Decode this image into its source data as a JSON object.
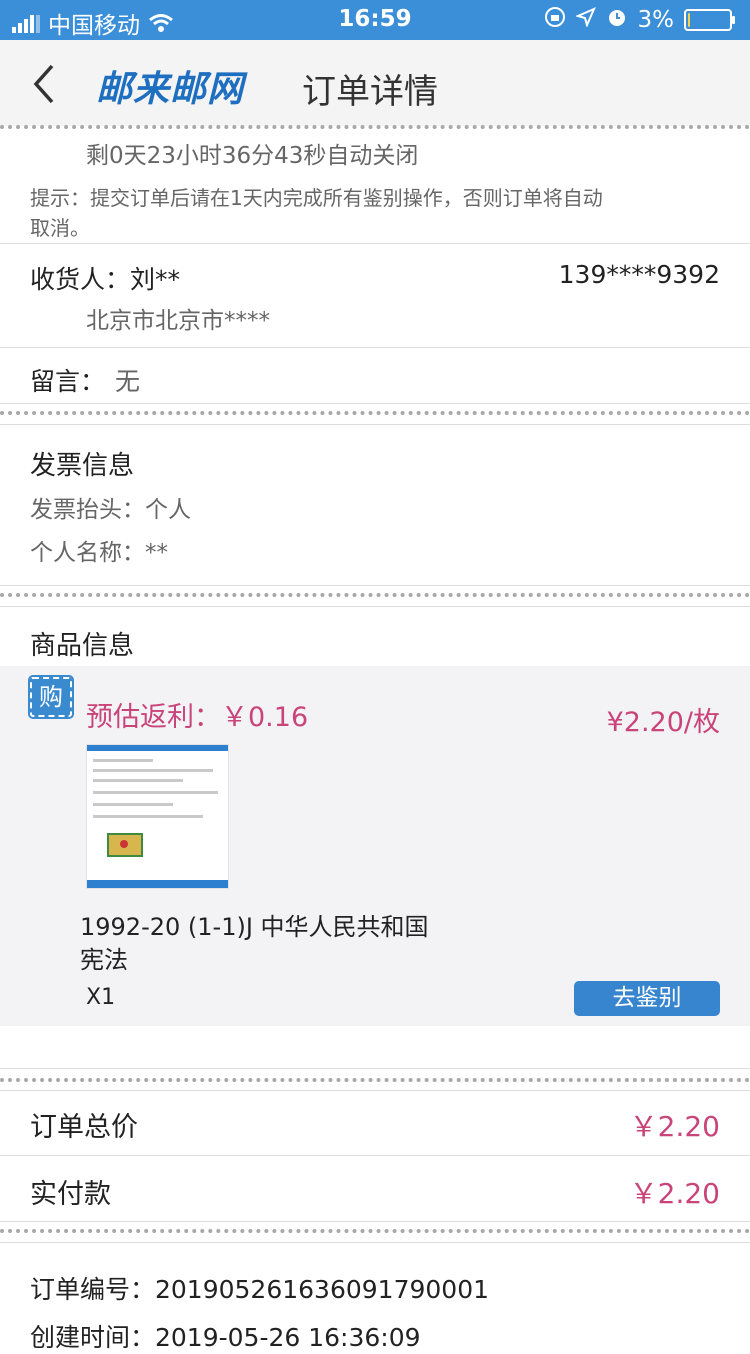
{
  "status_bar": {
    "carrier": "中国移动",
    "time": "16:59",
    "battery": "3%",
    "battery_level": 0.03
  },
  "nav": {
    "logo": "邮来邮网",
    "title": "订单详情"
  },
  "countdown": "剩0天23小时36分43秒自动关闭",
  "tip_line1": "提示：提交订单后请在1天内完成所有鉴别操作，否则订单将自动",
  "tip_line2": "取消。",
  "receiver": {
    "label": "收货人：刘**",
    "phone": "139****9392",
    "address": "北京市北京市****"
  },
  "message": {
    "label": "留言：",
    "value": "无"
  },
  "invoice": {
    "heading": "发票信息",
    "title_row": "发票抬头：个人",
    "name_row": "个人名称：**"
  },
  "product": {
    "heading": "商品信息",
    "buy_badge": "购",
    "rebate": "预估返利：￥0.16",
    "price": "¥2.20/枚",
    "name_line1": "1992-20 (1-1)J 中华人民共和国",
    "name_line2": "宪法",
    "qty": "X1",
    "identify_button": "去鉴别"
  },
  "totals": {
    "total_label": "订单总价",
    "total_value": "￥2.20",
    "paid_label": "实付款",
    "paid_value": "￥2.20"
  },
  "order": {
    "number": "订单编号：20190526163609179​0001",
    "created": "创建时间：2019-05-26 16:36:09"
  },
  "colors": {
    "status_bar": "#3a8fd8",
    "accent_pink": "#c9447a",
    "button_blue": "#3784cf"
  }
}
